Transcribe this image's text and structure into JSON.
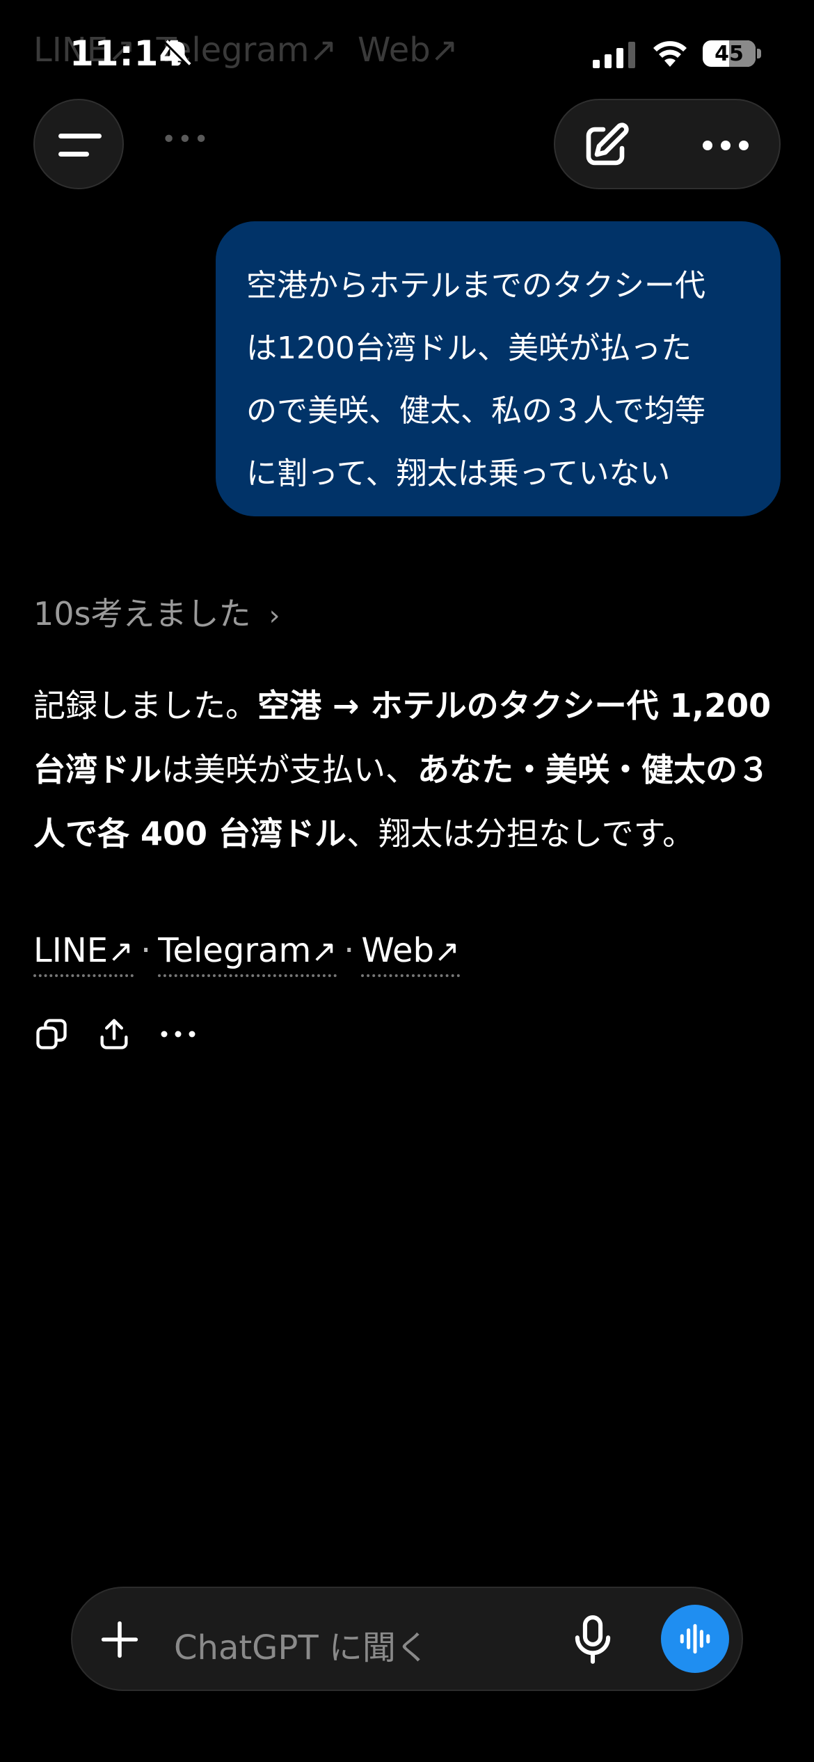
{
  "status_bar": {
    "time": "11:14",
    "battery": "45"
  },
  "background_links": [
    "LINE↗",
    "Telegram↗",
    "Web↗"
  ],
  "user_message": {
    "lines": [
      "空港からホテルまでのタクシー代",
      "は1200台湾ドル、美咲が払った",
      "ので美咲、健太、私の３人で均等",
      "に割って、翔太は乗っていない"
    ]
  },
  "thought": {
    "label": "10s考えました",
    "chevron": "›"
  },
  "assistant_message": {
    "p1": "記録しました。",
    "b1": "空港 → ホテルのタクシー代 1,200台湾ドル",
    "p2": "は美咲が支払い、",
    "b2": "あなた・美咲・健太の３人で各 400 台湾ドル",
    "p3": "、翔太は分担なしです。"
  },
  "links": {
    "line": "LINE",
    "telegram": "Telegram",
    "web": "Web",
    "arrow": "↗",
    "separator": "·"
  },
  "composer": {
    "placeholder": "ChatGPT に聞く"
  },
  "icons": {
    "menu": "menu-icon",
    "edit": "compose-icon",
    "more": "more-icon",
    "copy": "copy-icon",
    "share": "share-icon",
    "plus": "plus-icon",
    "mic": "microphone-icon",
    "voice": "voice-mode-icon"
  },
  "colors": {
    "user_bubble": "#013368",
    "voice_button": "#1f8ef1",
    "background": "#000000"
  }
}
